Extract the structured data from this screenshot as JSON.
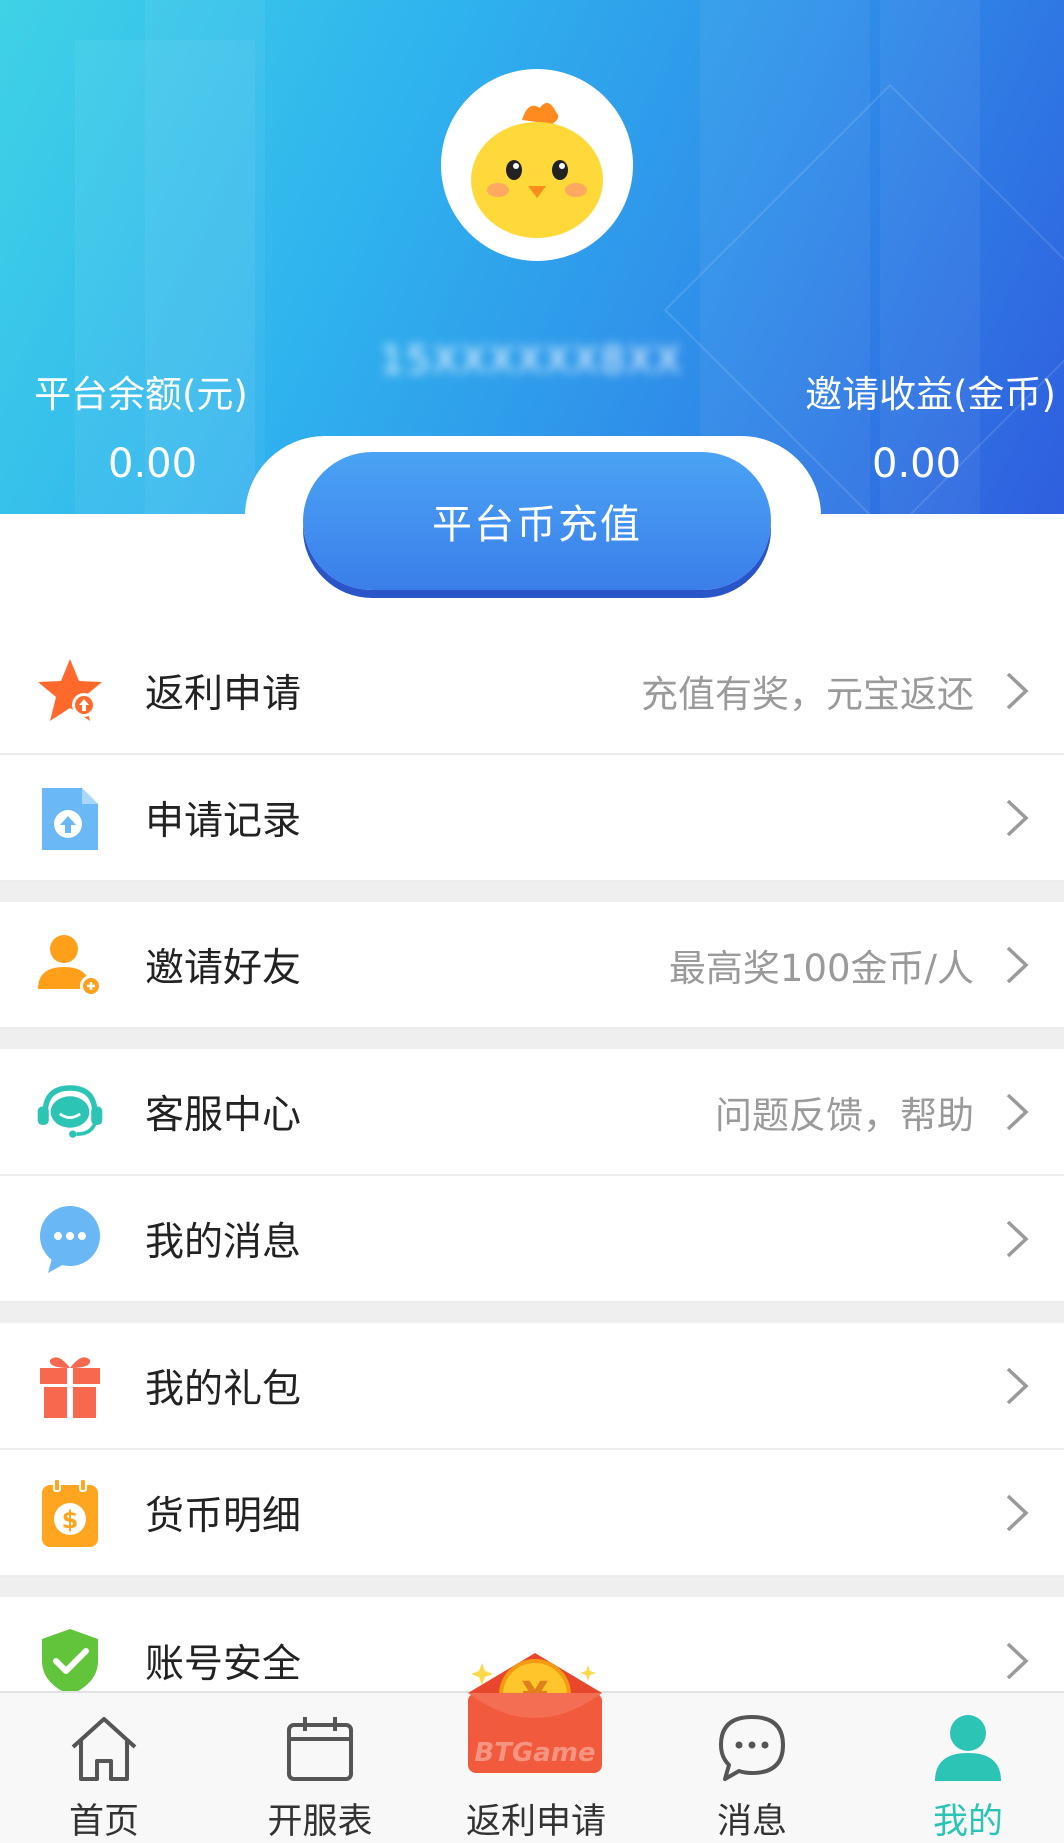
{
  "header": {
    "phone_number": "15XXXXXX8XX",
    "balance_label": "平台余额(元)",
    "balance_value": "0.00",
    "invite_label": "邀请收益(金币)",
    "invite_value": "0.00",
    "recharge_button": "平台币充值"
  },
  "menu": {
    "items": [
      {
        "label": "返利申请",
        "hint": "充值有奖，元宝返还"
      },
      {
        "label": "申请记录",
        "hint": ""
      },
      {
        "label": "邀请好友",
        "hint": "最高奖100金币/人"
      },
      {
        "label": "客服中心",
        "hint": "问题反馈，帮助"
      },
      {
        "label": "我的消息",
        "hint": ""
      },
      {
        "label": "我的礼包",
        "hint": ""
      },
      {
        "label": "货币明细",
        "hint": ""
      },
      {
        "label": "账号安全",
        "hint": ""
      }
    ]
  },
  "tabbar": {
    "tabs": [
      {
        "label": "首页",
        "icon": "home-icon"
      },
      {
        "label": "开服表",
        "icon": "calendar-icon"
      },
      {
        "label": "返利申请",
        "icon": "red-envelope-icon"
      },
      {
        "label": "消息",
        "icon": "chat-icon"
      },
      {
        "label": "我的",
        "icon": "person-icon",
        "active": true
      }
    ],
    "redpack_text": "BTGame"
  },
  "colors": {
    "accent_teal": "#2cc4b4",
    "header_blue": "#2f8fe9",
    "hint_gray": "#9a9a9a"
  }
}
